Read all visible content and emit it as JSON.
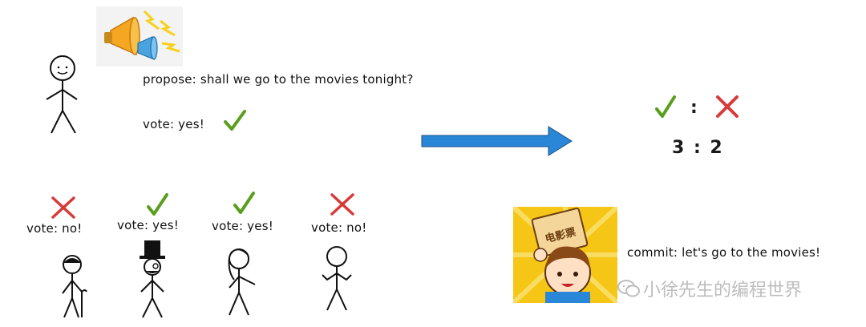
{
  "proposer": {
    "propose_text": "propose: shall we go to the movies tonight?",
    "vote_text": "vote: yes!"
  },
  "voters": [
    {
      "vote_text": "vote: no!",
      "vote": "no"
    },
    {
      "vote_text": "vote: yes!",
      "vote": "yes"
    },
    {
      "vote_text": "vote: yes!",
      "vote": "yes"
    },
    {
      "vote_text": "vote: no!",
      "vote": "no"
    }
  ],
  "result": {
    "separator": ":",
    "score": "3 : 2"
  },
  "commit_text": "commit: let's go to the movies!",
  "ticket_text": "电影票",
  "watermark": "小徐先生的编程世界",
  "colors": {
    "yes": "#5a9e1d",
    "no": "#d83a3a",
    "arrow": "#2a86d6",
    "arrow_outline": "#1a4f86"
  }
}
